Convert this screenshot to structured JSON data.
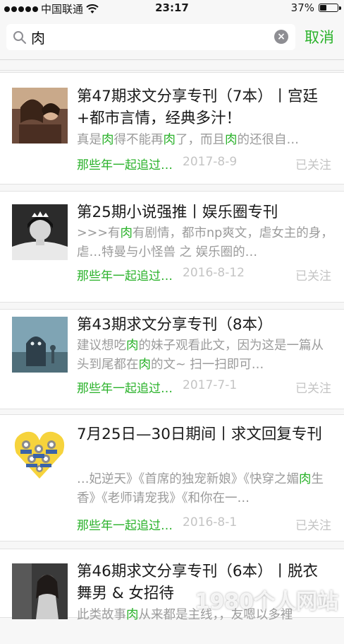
{
  "status_bar": {
    "carrier": "中国联通",
    "time": "23:17",
    "battery_percent": "37%",
    "battery_level": 0.37
  },
  "search": {
    "query": "肉",
    "cancel_label": "取消"
  },
  "results": [
    {
      "title": "第47期求文分享专刊（7本）丨宫廷+都市言情，经典多汁！",
      "snippet": [
        {
          "t": "真是"
        },
        {
          "t": "肉",
          "hl": true
        },
        {
          "t": "得不能再"
        },
        {
          "t": "肉",
          "hl": true
        },
        {
          "t": "了，而且"
        },
        {
          "t": "肉",
          "hl": true
        },
        {
          "t": "的还很自…"
        }
      ],
      "source": "那些年一起追过…",
      "date": "2017-8-9",
      "follow": "已关注",
      "thumb": "couple-photo"
    },
    {
      "title": "第25期小说强推丨娱乐圈专刊",
      "snippet": [
        {
          "t": ">>>有"
        },
        {
          "t": "肉",
          "hl": true
        },
        {
          "t": "有剧情，都市np爽文，虐女主的身，虐…特曼与小怪兽 之 娱乐圈的…"
        }
      ],
      "source": "那些年一起追过…",
      "date": "2016-8-12",
      "follow": "已关注",
      "thumb": "tiara-portrait"
    },
    {
      "title": "第43期求文分享专刊（8本）",
      "snippet": [
        {
          "t": "建议想吃"
        },
        {
          "t": "肉",
          "hl": true
        },
        {
          "t": "的妹子观看此文，因为这是一篇从头到尾都在"
        },
        {
          "t": "肉",
          "hl": true
        },
        {
          "t": "的文~ 扫一扫即可…"
        }
      ],
      "source": "那些年一起追过…",
      "date": "2017-7-1",
      "follow": "已关注",
      "thumb": "monster-scene"
    },
    {
      "title": "7月25日—30日期间丨求文回复专刊",
      "snippet": [
        {
          "t": "…妃逆天》《首席的独宠新娘》《快穿之媚"
        },
        {
          "t": "肉",
          "hl": true
        },
        {
          "t": "生香》《老师请宠我》《和你在一…"
        }
      ],
      "source": "那些年一起追过…",
      "date": "2016-8-1",
      "follow": "已关注",
      "thumb": "minions-heart"
    },
    {
      "title": "第46期求文分享专刊（6本）丨脱衣舞男 & 女招待",
      "snippet": [
        {
          "t": "此类故事"
        },
        {
          "t": "肉",
          "hl": true
        },
        {
          "t": "从来都是主线，，友嗯以多裡"
        }
      ],
      "source": "",
      "date": "",
      "follow": "",
      "thumb": "woman-photo"
    }
  ],
  "watermark": "1980个人网站",
  "colors": {
    "accent": "#2ab22a",
    "muted": "#9b9b9b"
  }
}
